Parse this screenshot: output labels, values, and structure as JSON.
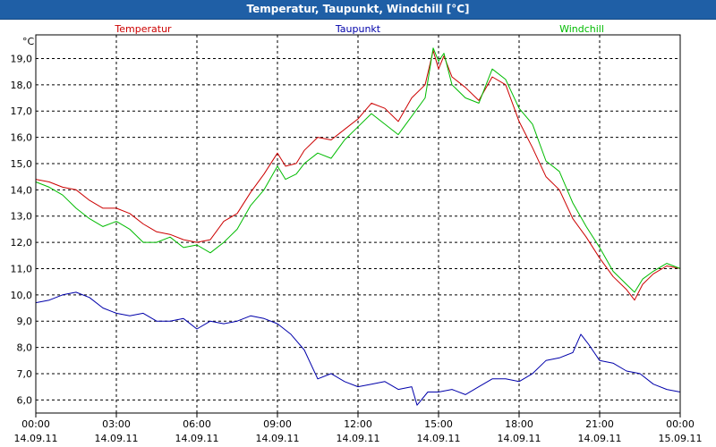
{
  "window": {
    "title": "Temperatur, Taupunkt, Windchill [°C]"
  },
  "chart_data": {
    "type": "line",
    "title": "Temperatur, Taupunkt, Windchill [°C]",
    "y_unit": "°C",
    "ylim": [
      5.5,
      19.9
    ],
    "yticks": [
      6,
      7,
      8,
      9,
      10,
      11,
      12,
      13,
      14,
      15,
      16,
      17,
      18,
      19
    ],
    "xlim": [
      0,
      24
    ],
    "xticks": [
      {
        "x": 0,
        "time": "00:00",
        "date": "14.09.11"
      },
      {
        "x": 3,
        "time": "03:00",
        "date": "14.09.11"
      },
      {
        "x": 6,
        "time": "06:00",
        "date": "14.09.11"
      },
      {
        "x": 9,
        "time": "09:00",
        "date": "14.09.11"
      },
      {
        "x": 12,
        "time": "12:00",
        "date": "14.09.11"
      },
      {
        "x": 15,
        "time": "15:00",
        "date": "14.09.11"
      },
      {
        "x": 18,
        "time": "18:00",
        "date": "14.09.11"
      },
      {
        "x": 21,
        "time": "21:00",
        "date": "14.09.11"
      },
      {
        "x": 24,
        "time": "00:00",
        "date": "15.09.11"
      }
    ],
    "grid": true,
    "legend": "top",
    "series": [
      {
        "name": "Temperatur",
        "color": "#cc0000",
        "points": [
          [
            0,
            14.4
          ],
          [
            0.5,
            14.3
          ],
          [
            1,
            14.1
          ],
          [
            1.5,
            14.0
          ],
          [
            2,
            13.6
          ],
          [
            2.5,
            13.3
          ],
          [
            3,
            13.3
          ],
          [
            3.5,
            13.1
          ],
          [
            4,
            12.7
          ],
          [
            4.5,
            12.4
          ],
          [
            5,
            12.3
          ],
          [
            5.5,
            12.1
          ],
          [
            6,
            12.0
          ],
          [
            6.5,
            12.1
          ],
          [
            7,
            12.8
          ],
          [
            7.5,
            13.1
          ],
          [
            8,
            13.9
          ],
          [
            8.5,
            14.6
          ],
          [
            9,
            15.4
          ],
          [
            9.3,
            14.9
          ],
          [
            9.7,
            15.0
          ],
          [
            10,
            15.5
          ],
          [
            10.5,
            16.0
          ],
          [
            11,
            15.9
          ],
          [
            11.5,
            16.3
          ],
          [
            12,
            16.7
          ],
          [
            12.5,
            17.3
          ],
          [
            13,
            17.1
          ],
          [
            13.5,
            16.6
          ],
          [
            14,
            17.5
          ],
          [
            14.5,
            18.0
          ],
          [
            14.8,
            19.3
          ],
          [
            15,
            18.6
          ],
          [
            15.2,
            19.1
          ],
          [
            15.5,
            18.3
          ],
          [
            16,
            17.9
          ],
          [
            16.5,
            17.4
          ],
          [
            17,
            18.3
          ],
          [
            17.5,
            18.0
          ],
          [
            18,
            16.6
          ],
          [
            18.5,
            15.6
          ],
          [
            19,
            14.5
          ],
          [
            19.5,
            14.0
          ],
          [
            20,
            12.9
          ],
          [
            20.5,
            12.2
          ],
          [
            21,
            11.4
          ],
          [
            21.5,
            10.7
          ],
          [
            22,
            10.2
          ],
          [
            22.3,
            9.8
          ],
          [
            22.6,
            10.4
          ],
          [
            23,
            10.8
          ],
          [
            23.5,
            11.1
          ],
          [
            24,
            11.0
          ]
        ]
      },
      {
        "name": "Taupunkt",
        "color": "#0000aa",
        "points": [
          [
            0,
            9.7
          ],
          [
            0.5,
            9.8
          ],
          [
            1,
            10.0
          ],
          [
            1.5,
            10.1
          ],
          [
            2,
            9.9
          ],
          [
            2.5,
            9.5
          ],
          [
            3,
            9.3
          ],
          [
            3.5,
            9.2
          ],
          [
            4,
            9.3
          ],
          [
            4.5,
            9.0
          ],
          [
            5,
            9.0
          ],
          [
            5.5,
            9.1
          ],
          [
            6,
            8.7
          ],
          [
            6.5,
            9.0
          ],
          [
            7,
            8.9
          ],
          [
            7.5,
            9.0
          ],
          [
            8,
            9.2
          ],
          [
            8.5,
            9.1
          ],
          [
            9,
            8.9
          ],
          [
            9.5,
            8.5
          ],
          [
            10,
            7.9
          ],
          [
            10.5,
            6.8
          ],
          [
            11,
            7.0
          ],
          [
            11.5,
            6.7
          ],
          [
            12,
            6.5
          ],
          [
            12.5,
            6.6
          ],
          [
            13,
            6.7
          ],
          [
            13.5,
            6.4
          ],
          [
            14,
            6.5
          ],
          [
            14.2,
            5.8
          ],
          [
            14.6,
            6.3
          ],
          [
            15,
            6.3
          ],
          [
            15.5,
            6.4
          ],
          [
            16,
            6.2
          ],
          [
            16.5,
            6.5
          ],
          [
            17,
            6.8
          ],
          [
            17.5,
            6.8
          ],
          [
            18,
            6.7
          ],
          [
            18.5,
            7.0
          ],
          [
            19,
            7.5
          ],
          [
            19.5,
            7.6
          ],
          [
            20,
            7.8
          ],
          [
            20.3,
            8.5
          ],
          [
            20.6,
            8.1
          ],
          [
            21,
            7.5
          ],
          [
            21.5,
            7.4
          ],
          [
            22,
            7.1
          ],
          [
            22.5,
            7.0
          ],
          [
            23,
            6.6
          ],
          [
            23.5,
            6.4
          ],
          [
            24,
            6.3
          ]
        ]
      },
      {
        "name": "Windchill",
        "color": "#00bb00",
        "points": [
          [
            0,
            14.3
          ],
          [
            0.5,
            14.1
          ],
          [
            1,
            13.8
          ],
          [
            1.5,
            13.3
          ],
          [
            2,
            12.9
          ],
          [
            2.5,
            12.6
          ],
          [
            3,
            12.8
          ],
          [
            3.5,
            12.5
          ],
          [
            4,
            12.0
          ],
          [
            4.5,
            12.0
          ],
          [
            5,
            12.2
          ],
          [
            5.5,
            11.8
          ],
          [
            6,
            11.9
          ],
          [
            6.5,
            11.6
          ],
          [
            7,
            12.0
          ],
          [
            7.5,
            12.5
          ],
          [
            8,
            13.4
          ],
          [
            8.5,
            14.0
          ],
          [
            9,
            14.9
          ],
          [
            9.3,
            14.4
          ],
          [
            9.7,
            14.6
          ],
          [
            10,
            15.0
          ],
          [
            10.5,
            15.4
          ],
          [
            11,
            15.2
          ],
          [
            11.5,
            15.9
          ],
          [
            12,
            16.4
          ],
          [
            12.5,
            16.9
          ],
          [
            13,
            16.5
          ],
          [
            13.5,
            16.1
          ],
          [
            14,
            16.8
          ],
          [
            14.5,
            17.5
          ],
          [
            14.8,
            19.4
          ],
          [
            15,
            18.9
          ],
          [
            15.2,
            19.2
          ],
          [
            15.5,
            18.0
          ],
          [
            16,
            17.5
          ],
          [
            16.5,
            17.3
          ],
          [
            17,
            18.6
          ],
          [
            17.5,
            18.2
          ],
          [
            18,
            17.1
          ],
          [
            18.5,
            16.5
          ],
          [
            19,
            15.1
          ],
          [
            19.5,
            14.7
          ],
          [
            20,
            13.5
          ],
          [
            20.5,
            12.6
          ],
          [
            21,
            11.8
          ],
          [
            21.5,
            10.9
          ],
          [
            22,
            10.4
          ],
          [
            22.3,
            10.1
          ],
          [
            22.6,
            10.6
          ],
          [
            23,
            10.9
          ],
          [
            23.5,
            11.2
          ],
          [
            24,
            11.0
          ]
        ]
      }
    ]
  }
}
